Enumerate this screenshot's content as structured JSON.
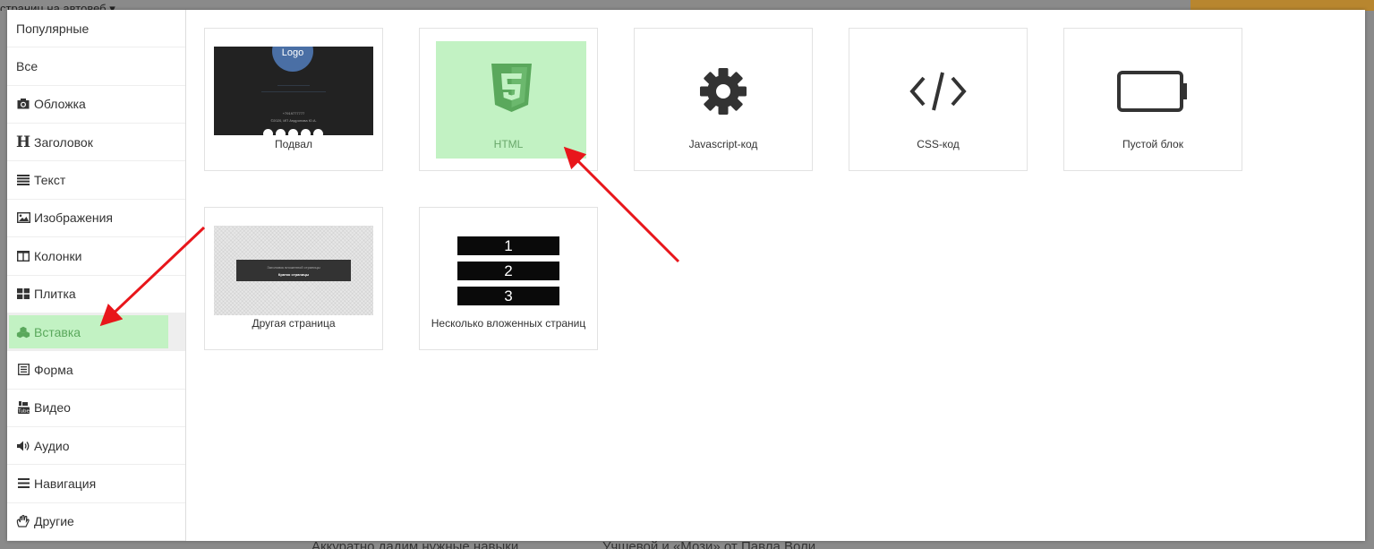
{
  "background": {
    "top_text": "страниц на автовеб ▾",
    "bottom_left_text": "Аккуратно дадим нужные навыки",
    "bottom_right_text": "Учшевой и «Мози» от Павла Воли"
  },
  "sidebar": {
    "items": [
      {
        "label": "Популярные",
        "icon": "",
        "active": false
      },
      {
        "label": "Все",
        "icon": "",
        "active": false
      },
      {
        "label": "Обложка",
        "icon": "camera-icon",
        "active": false
      },
      {
        "label": "Заголовок",
        "icon": "heading-icon",
        "active": false
      },
      {
        "label": "Текст",
        "icon": "text-lines-icon",
        "active": false
      },
      {
        "label": "Изображения",
        "icon": "image-icon",
        "active": false
      },
      {
        "label": "Колонки",
        "icon": "columns-icon",
        "active": false
      },
      {
        "label": "Плитка",
        "icon": "tiles-icon",
        "active": false
      },
      {
        "label": "Вставка",
        "icon": "cubes-icon",
        "active": true
      },
      {
        "label": "Форма",
        "icon": "form-icon",
        "active": false
      },
      {
        "label": "Видео",
        "icon": "youtube-icon",
        "active": false
      },
      {
        "label": "Аудио",
        "icon": "volume-icon",
        "active": false
      },
      {
        "label": "Навигация",
        "icon": "menu-icon",
        "active": false
      },
      {
        "label": "Другие",
        "icon": "hand-icon",
        "active": false
      }
    ]
  },
  "blocks": {
    "footer": {
      "label": "Подвал",
      "thumb_logo": "Logo",
      "thumb_line1": "©2020, ИП Андропова Ю.А.",
      "thumb_phone": "+7919777777"
    },
    "html": {
      "label": "HTML",
      "icon": "html5-icon"
    },
    "javascript": {
      "label": "Javascript-код",
      "icon": "gear-icon"
    },
    "css": {
      "label": "CSS-код",
      "icon": "code-icon"
    },
    "empty": {
      "label": "Пустой блок",
      "icon": "empty-battery-icon"
    },
    "other_page": {
      "label": "Другая страница",
      "thumb_caption": "Заголовок вложенной страницы",
      "thumb_button": "Кратко страницы"
    },
    "nested_pages": {
      "label": "Несколько вложенных страниц",
      "rows": [
        "1",
        "2",
        "3"
      ]
    }
  },
  "colors": {
    "highlight": "#c2f2c3",
    "highlight_text": "#5aa85c",
    "html5_icon": "#5aa85c",
    "arrow": "#e8161b"
  }
}
